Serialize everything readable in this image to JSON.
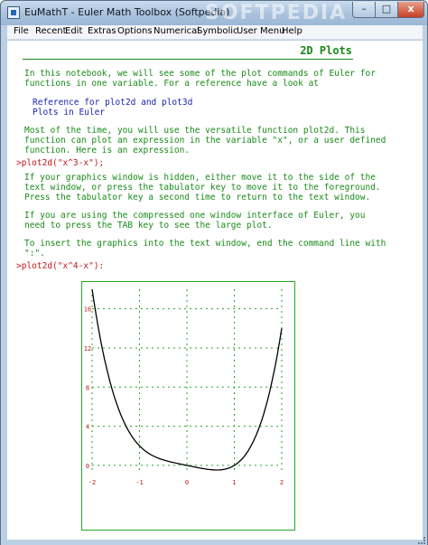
{
  "window": {
    "title": "EuMathT - Euler Math Toolbox (Softpedia)",
    "watermark": "SOFTPEDIA",
    "minimize_label": "–",
    "maximize_label": "□",
    "close_label": "x"
  },
  "menu": [
    "File",
    "Recent",
    "Edit",
    "Extras",
    "Options",
    "Numerical",
    "Symbolic",
    "User Menu",
    "Help"
  ],
  "notebook": {
    "heading": "2D Plots",
    "intro_lines": [
      "In this notebook, we will see some of the plot commands of Euler for",
      "functions in one variable. For a reference have a look at"
    ],
    "links": [
      "Reference for plot2d and plot3d",
      "Plots in Euler"
    ],
    "para2_lines": [
      "Most of the time, you will use the versatile function plot2d. This",
      "function can plot an expression in the variable \"x\", or a user defined",
      "function. Here is an expression."
    ],
    "command1": ">plot2d(\"x^3-x\");",
    "para3_lines": [
      "If your graphics window is hidden, either move it to the side of the",
      "text window, or press the tabulator key to move it to the foreground.",
      "Press the tabulator key a second time to return to the text window."
    ],
    "para4_lines": [
      "If you are using the compressed one window interface of Euler, you",
      "need to press the TAB key to see the large plot."
    ],
    "para5_lines": [
      "To insert the graphics into the text window, end the command line with",
      "\":\"."
    ],
    "command2": ">plot2d(\"x^4-x\"):"
  },
  "chart_data": {
    "type": "line",
    "expression": "x^4-x",
    "xlim": [
      -2,
      2
    ],
    "ylim": [
      -0.47,
      18
    ],
    "x_ticks": [
      "-2",
      "-1",
      "0",
      "1",
      "2"
    ],
    "y_ticks": [
      "0",
      "4",
      "8",
      "12",
      "16"
    ],
    "grid": true,
    "colors": {
      "curve": "#000000",
      "grid": "#22aa22",
      "frame": "#22aa22",
      "tick_labels": "#c01818"
    }
  }
}
